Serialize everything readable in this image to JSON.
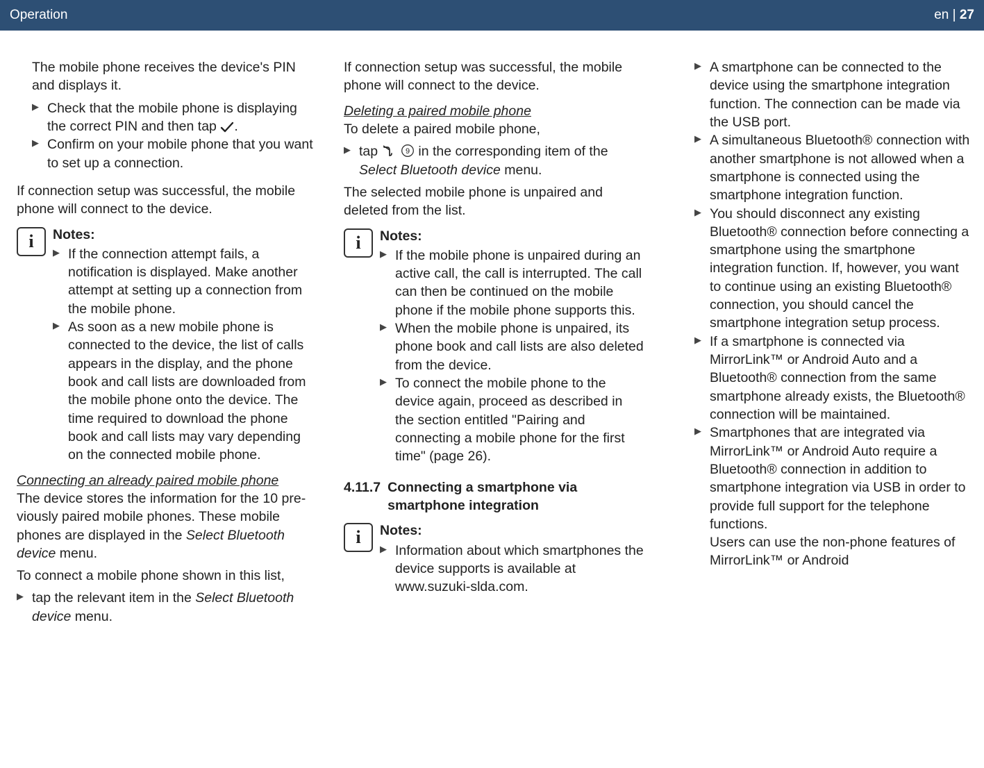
{
  "header": {
    "section": "Operation",
    "lang": "en",
    "sep": " | ",
    "page": "27"
  },
  "col1": {
    "p1": "The mobile phone receives the device's PIN and displays it.",
    "b1_pre": "Check that the mobile phone is displaying the correct PIN and then tap ",
    "b1_post": ".",
    "b2": "Confirm on your mobile phone that you want to set up a connection.",
    "p2": "If connection setup was successful, the mobile phone will connect to the device.",
    "notes_title": "Notes:",
    "n1": "If the connection attempt fails, a notification is displayed. Make another attempt at setting up a connection from the mobile phone.",
    "n2": "As soon as a new mobile phone is connected to the device, the list of calls appears in the display, and the phone book and call lists are down­loaded from the mobile phone onto the device. The time required to download the phone book and call lists may vary depending on the connected mobile phone.",
    "sub1": "Connecting an already paired mobile phone",
    "p3a": "The device stores the information for the 10 pre­viously paired mobile phones. These mobile phones are displayed in the ",
    "p3b": "Select Bluetooth device",
    "p3c": " menu.",
    "p4": "To connect a mobile phone shown in this list,",
    "b3a": "tap the relevant item in the ",
    "b3b": "Select Bluetooth device",
    "b3c": " menu."
  },
  "col2": {
    "p1": "If connection setup was successful, the mobile phone will connect to the device.",
    "sub1": "Deleting a paired mobile phone",
    "p2": "To delete a paired mobile phone,",
    "b1_pre": "tap ",
    "b1_num": "9",
    "b1_mid": " in the corresponding item of the ",
    "b1_it": "Select Bluetooth device",
    "b1_post": " menu.",
    "p3": "The selected mobile phone is unpaired and deleted from the list.",
    "notes_title": "Notes:",
    "n1": "If the mobile phone is unpaired during an active call, the call is interrupted. The call can then be continued on the mobile phone if the mobile phone supports this.",
    "n2": "When the mobile phone is unpaired, its phone book and call lists are also deleted from the device.",
    "n3": "To connect the mobile phone to the device again, proceed as described in the section entitled \"Pairing and connecting a mobile phone for the first time\" (page 26).",
    "sec_num": "4.11.7",
    "sec_title": "Connecting a smartphone via smartphone integration",
    "notes2_title": "Notes:",
    "n2_1": "Information about which smart­phones the device supports is avail­able at www.suzuki-slda.com."
  },
  "col3": {
    "b1": "A smartphone can be connected to the device using the smartphone integration function. The connec­tion can be made via the USB port.",
    "b2": "A simultaneous Bluetooth® connec­tion with another smartphone is not allowed when a smartphone is connected using the smartphone integration function.",
    "b3": "You should disconnect any existing Bluetooth® connection before con­necting a smartphone using the smartphone integration function. If, however, you want to continue using an existing Bluetooth® con­nection, you should cancel the smartphone integration setup pro­cess.",
    "b4": "If a smartphone is connected via MirrorLink™ or Android Auto and a Bluetooth® connection from the same smartphone already exists, the Bluetooth® connection will be maintained.",
    "b5": "Smartphones that are integrated via MirrorLink™ or Android Auto require a Bluetooth® connection in addition to smartphone integration via USB in order to provide full support for the telephone functions.",
    "b5b": "Users can use the non-phone fea­tures of MirrorLink™ or Android"
  }
}
